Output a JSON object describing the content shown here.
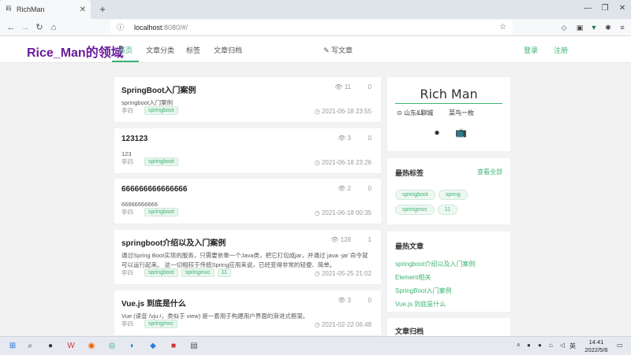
{
  "browser": {
    "tab_title": "RichMan",
    "tab_favicon": "码",
    "url_host": "localhost",
    "url_rest": ":8080/#/"
  },
  "site": {
    "logo": "Rice_Man的领域",
    "nav": [
      "首页",
      "文章分类",
      "标签",
      "文章归档"
    ],
    "write": "写文章",
    "login": "登录",
    "register": "注册",
    "accent": "#3cb371",
    "logo_color": "#6a1b9a"
  },
  "articles": [
    {
      "title": "SpringBoot入门案例",
      "views": "11",
      "comments": "0",
      "summary": "springboot入门案例",
      "author": "李四",
      "tags": [
        "springboot"
      ],
      "date": "2021-06-18 23:55"
    },
    {
      "title": "123123",
      "views": "3",
      "comments": "0",
      "summary": "123",
      "author": "李四",
      "tags": [
        "springboot"
      ],
      "date": "2021-06-18 23:26"
    },
    {
      "title": "666666666666666",
      "views": "2",
      "comments": "0",
      "summary": "66666666666",
      "author": "李四",
      "tags": [
        "springboot"
      ],
      "date": "2021-06-18 00:35"
    },
    {
      "title": "springboot介绍以及入门案例",
      "views": "128",
      "comments": "1",
      "summary": "通过Spring Boot实现的服务，只需要依靠一个Java类，把它打包成jar，并通过`java -jar`命令就可以运行起来。 这一切相较于传统Spring应用来说，已经变得非常的轻便、简单。",
      "author": "李四",
      "tags": [
        "springboot",
        "springmvc",
        "11"
      ],
      "date": "2021-05-25 21:02"
    },
    {
      "title": "Vue.js 到底是什么",
      "views": "3",
      "comments": "0",
      "summary": "Vue (读音 /vjuː/，类似于 view) 是一套用于构建用户界面的渐进式框架。",
      "author": "李四",
      "tags": [
        "springmvc"
      ],
      "date": "2021-02-22 06:48"
    }
  ],
  "profile": {
    "name": "Rich Man",
    "location": "山东&聊城",
    "job": "菜鸟一枚"
  },
  "hot_tags": {
    "title": "最热标签",
    "view_all": "查看全部",
    "tags": [
      "springboot",
      "spring",
      "springmvc",
      "11"
    ]
  },
  "hot_articles": {
    "title": "最热文章",
    "items": [
      "springboot介绍以及入门案例",
      "Element相关",
      "SpringBoot入门案例",
      "Vue.js 到底是什么"
    ]
  },
  "archive": {
    "title": "文章归档"
  },
  "taskbar": {
    "time": "14:41",
    "date": "2022/5/6",
    "lang": "英"
  }
}
